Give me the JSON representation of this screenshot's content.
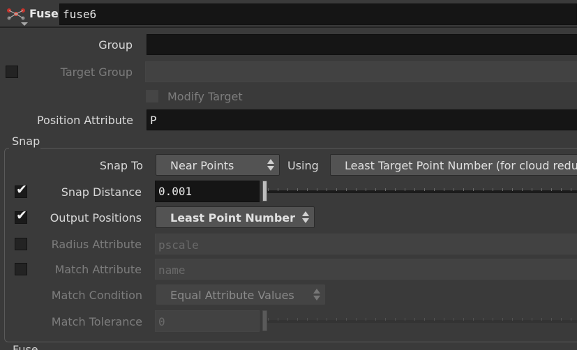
{
  "header": {
    "node_type": "Fuse",
    "node_name": "fuse6"
  },
  "params": {
    "group_label": "Group",
    "group_value": "",
    "target_group_label": "Target Group",
    "target_group_value": "",
    "modify_target_label": "Modify Target",
    "position_attribute_label": "Position Attribute",
    "position_attribute_value": "P"
  },
  "snap": {
    "section_title": "Snap",
    "snap_to_label": "Snap To",
    "snap_to_value": "Near Points",
    "using_label": "Using",
    "using_value": "Least Target Point Number (for cloud reductio",
    "snap_distance_label": "Snap Distance",
    "snap_distance_value": "0.001",
    "snap_distance_enabled": true,
    "output_positions_label": "Output Positions",
    "output_positions_value": "Least Point Number",
    "output_positions_enabled": true,
    "radius_attribute_label": "Radius Attribute",
    "radius_attribute_value": "pscale",
    "match_attribute_label": "Match Attribute",
    "match_attribute_value": "name",
    "match_condition_label": "Match Condition",
    "match_condition_value": "Equal Attribute Values",
    "match_tolerance_label": "Match Tolerance",
    "match_tolerance_value": "0"
  },
  "footer": {
    "next_section_label": "Fuse"
  },
  "colors": {
    "panel_bg": "#3a3a3a",
    "field_dark": "#151515",
    "button_bg": "#535353",
    "icon_red": "#c8342c"
  },
  "icons": {
    "node_icon": "fuse-node-icon",
    "check": "checkmark-icon",
    "spinner": "menu-spinner-icon"
  }
}
